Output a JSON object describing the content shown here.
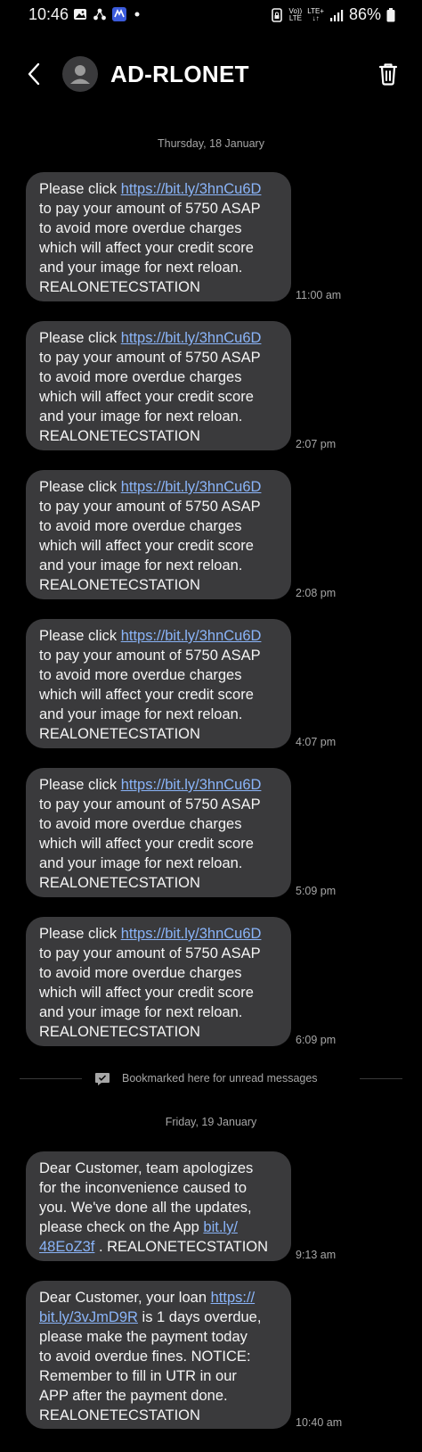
{
  "status_bar": {
    "time": "10:46",
    "volte_top": "Vo))",
    "volte_bottom": "LTE",
    "network_top": "LTE+",
    "network_bottom": "↓↑",
    "battery": "86%"
  },
  "header": {
    "contact_name": "AD-RLONET"
  },
  "conversation": {
    "date_1": "Thursday, 18 January",
    "date_2": "Friday, 19 January",
    "bookmark_text": "Bookmarked here for unread messages",
    "messages_day1": [
      {
        "pre": "Please click ",
        "link": "https://bit.ly/3hnCu6D",
        "lines": [
          "to pay your amount of 5750 ASAP",
          "to avoid more overdue charges",
          "which will affect your credit score",
          "and your image for next reloan.",
          "REALONETECSTATION"
        ],
        "time": "11:00 am"
      },
      {
        "pre": "Please click ",
        "link": "https://bit.ly/3hnCu6D",
        "lines": [
          "to pay your amount of 5750 ASAP",
          "to avoid more overdue charges",
          "which will affect your credit score",
          "and your image for next reloan.",
          "REALONETECSTATION"
        ],
        "time": "2:07 pm"
      },
      {
        "pre": "Please click ",
        "link": "https://bit.ly/3hnCu6D",
        "lines": [
          "to pay your amount of 5750 ASAP",
          "to avoid more overdue charges",
          "which will affect your credit score",
          "and your image for next reloan.",
          "REALONETECSTATION"
        ],
        "time": "2:08 pm"
      },
      {
        "pre": "Please click ",
        "link": "https://bit.ly/3hnCu6D",
        "lines": [
          "to pay your amount of 5750 ASAP",
          "to avoid more overdue charges",
          "which will affect your credit score",
          "and your image for next reloan.",
          "REALONETECSTATION"
        ],
        "time": "4:07 pm"
      },
      {
        "pre": "Please click ",
        "link": "https://bit.ly/3hnCu6D",
        "lines": [
          "to pay your amount of 5750 ASAP",
          "to avoid more overdue charges",
          "which will affect your credit score",
          "and your image for next reloan.",
          "REALONETECSTATION"
        ],
        "time": "5:09 pm"
      },
      {
        "pre": "Please click ",
        "link": "https://bit.ly/3hnCu6D",
        "lines": [
          "to pay your amount of 5750 ASAP",
          "to avoid more overdue charges",
          "which will affect your credit score",
          "and your image for next reloan.",
          "REALONETECSTATION"
        ],
        "time": "6:09 pm"
      }
    ],
    "message_7": {
      "line_1": "Dear Customer,  team apologizes",
      "line_2": "for the inconvenience caused to",
      "line_3": "you. We've done all the updates,",
      "line_4_pre": "please check on the App ",
      "line_4_link": "bit.ly/",
      "line_5_link": "48EoZ3f",
      "line_5_post": " . REALONETECSTATION",
      "time": "9:13 am"
    },
    "message_8": {
      "line_1_pre": "Dear Customer, your loan ",
      "line_1_link": "https://",
      "line_2_link": "bit.ly/3vJmD9R",
      "line_2_post": " is 1 days overdue,",
      "line_3": "please make the payment today",
      "line_4": "to avoid overdue fines. NOTICE:",
      "line_5": "Remember to fill in UTR in our",
      "line_6": "APP after the payment done.",
      "line_7": "REALONETECSTATION",
      "time": "10:40 am"
    }
  },
  "icons": {
    "gallery": "gallery-icon",
    "share": "share-nodes-icon",
    "app": "app-badge-icon",
    "back": "chevron-left-icon",
    "avatar": "person-icon",
    "delete": "trash-icon",
    "bookmark": "message-bookmark-icon"
  },
  "colors": {
    "background": "#000000",
    "bubble": "#3a3a3c",
    "link": "#8ab4f8",
    "meta_text": "#a6a6a6",
    "app_badge": "#3b5bdb"
  }
}
